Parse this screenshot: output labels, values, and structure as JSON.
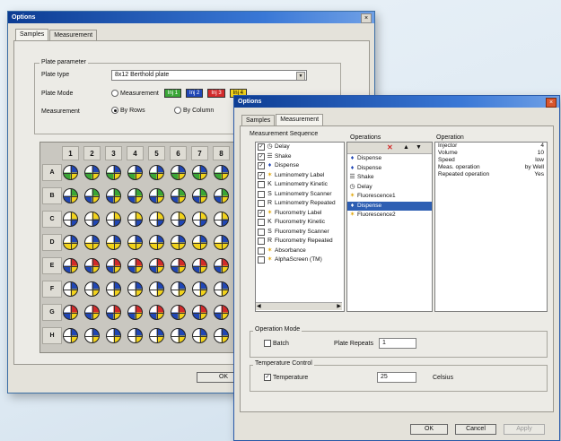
{
  "back_window": {
    "title": "Options",
    "close": "×",
    "tabs": [
      "Samples",
      "Measurement"
    ],
    "plate_parameter": {
      "group_label": "Plate parameter",
      "plate_type_label": "Plate type",
      "plate_type_value": "8x12 Berthold plate",
      "plate_mode_label": "Plate Mode",
      "plate_mode_option": "Measurement",
      "badges": [
        {
          "text": "Inj 1",
          "color": "#3aa637"
        },
        {
          "text": "Inj 2",
          "color": "#2046b5"
        },
        {
          "text": "Inj 3",
          "color": "#d22b2b"
        },
        {
          "text": "Inj 4",
          "color": "#f2d31b"
        }
      ],
      "measurement_label": "Measurement",
      "by_rows": "By Rows",
      "by_columns": "By Column"
    },
    "grid": {
      "columns": [
        "1",
        "2",
        "3",
        "4",
        "5",
        "6",
        "7",
        "8"
      ],
      "rows": [
        "A",
        "B",
        "C",
        "D",
        "E",
        "F",
        "G",
        "H"
      ],
      "row_colors": [
        [
          "#2046b5",
          "#f2d31b",
          "#3aa637",
          "#fff"
        ],
        [
          "#3aa637",
          "#f2d31b",
          "#2046b5",
          "#fff"
        ],
        [
          "#f2d31b",
          "#2046b5",
          "#fff",
          "#fff"
        ],
        [
          "#2046b5",
          "#f2d31b",
          "#f2d31b",
          "#fff"
        ],
        [
          "#d22b2b",
          "#f2d31b",
          "#2046b5",
          "#fff"
        ],
        [
          "#2046b5",
          "#f2d31b",
          "#fff",
          "#fff"
        ],
        [
          "#d22b2b",
          "#f2d31b",
          "#2046b5",
          "#fff"
        ],
        [
          "#2046b5",
          "#f2d31b",
          "#fff",
          "#fff"
        ]
      ]
    },
    "ok": "OK"
  },
  "front_window": {
    "title": "Options",
    "close": "×",
    "tabs": [
      "Samples",
      "Measurement"
    ],
    "seq_label": "Measurement Sequence",
    "operations_label": "Operations",
    "operation_label": "Operation",
    "available_items": [
      {
        "checked": true,
        "icon": "clock-icon",
        "glyph": "◷",
        "label": "Delay"
      },
      {
        "checked": true,
        "icon": "shake-icon",
        "glyph": "☰",
        "label": "Shake"
      },
      {
        "checked": true,
        "icon": "dispense-icon",
        "glyph": "♦",
        "label": "Dispense"
      },
      {
        "checked": true,
        "icon": "luminescence-icon",
        "glyph": "✶",
        "label": "Luminometry Label"
      },
      {
        "checked": false,
        "icon": "kinetic-icon",
        "glyph": "K",
        "label": "Luminometry Kinetic"
      },
      {
        "checked": false,
        "icon": "scan-icon",
        "glyph": "S",
        "label": "Luminometry Scanner"
      },
      {
        "checked": false,
        "icon": "repeat-icon",
        "glyph": "R",
        "label": "Luminometry Repeated"
      },
      {
        "checked": true,
        "icon": "fluorescence-icon",
        "glyph": "✶",
        "label": "Fluorometry Label"
      },
      {
        "checked": false,
        "icon": "kinetic-icon",
        "glyph": "K",
        "label": "Fluorometry Kinetic"
      },
      {
        "checked": false,
        "icon": "scan-icon",
        "glyph": "S",
        "label": "Fluorometry Scanner"
      },
      {
        "checked": false,
        "icon": "repeat-icon",
        "glyph": "R",
        "label": "Fluorometry Repeated"
      },
      {
        "checked": false,
        "icon": "absorbance-icon",
        "glyph": "✶",
        "label": "Absorbance"
      },
      {
        "checked": false,
        "icon": "alphascreen-icon",
        "glyph": "✶",
        "label": "AlphaScreen (TM)"
      }
    ],
    "sequence_items": [
      {
        "icon": "dispense-icon",
        "glyph": "♦",
        "label": "Dispense",
        "selected": false
      },
      {
        "icon": "dispense-icon",
        "glyph": "♦",
        "label": "Dispense",
        "selected": false
      },
      {
        "icon": "shake-icon",
        "glyph": "☰",
        "label": "Shake",
        "selected": false
      },
      {
        "icon": "clock-icon",
        "glyph": "◷",
        "label": "Delay",
        "selected": false
      },
      {
        "icon": "fluorescence-icon",
        "glyph": "✶",
        "label": "Fluorescence1",
        "selected": false
      },
      {
        "icon": "dispense-icon",
        "glyph": "♦",
        "label": "Dispense",
        "selected": true
      },
      {
        "icon": "fluorescence-icon",
        "glyph": "✶",
        "label": "Fluorescence2",
        "selected": false
      }
    ],
    "properties": [
      {
        "name": "Injector",
        "value": "4"
      },
      {
        "name": "Volume",
        "value": "10"
      },
      {
        "name": "Speed",
        "value": "low"
      },
      {
        "name": "Meas. operation",
        "value": "by Well"
      },
      {
        "name": "Repeated operation",
        "value": "Yes"
      }
    ],
    "toolbar": {
      "delete": "✕",
      "up": "▲",
      "down": "▼"
    },
    "operation_mode": {
      "label": "Operation Mode",
      "batch_label": "Batch",
      "plate_repeats_label": "Plate Repeats",
      "plate_repeats_value": "1"
    },
    "temperature": {
      "label": "Temperature Control",
      "temp_label": "Temperature",
      "value": "25",
      "unit": "Celsius"
    },
    "buttons": {
      "ok": "OK",
      "cancel": "Cancel",
      "apply": "Apply"
    }
  }
}
